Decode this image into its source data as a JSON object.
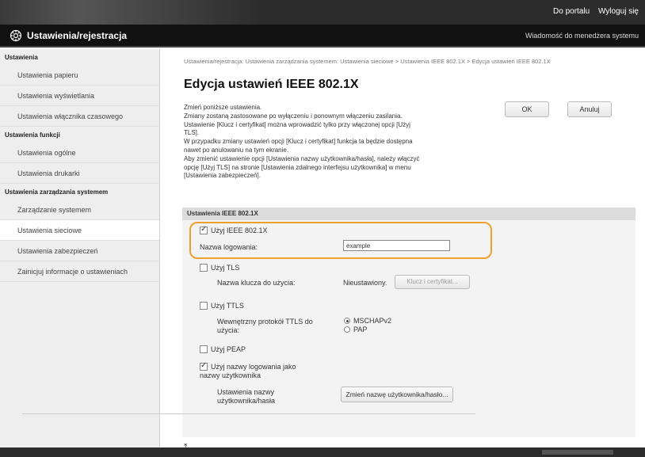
{
  "header": {
    "portal_link": "Do portalu",
    "logout_link": "Wyloguj się",
    "app_title": "Ustawienia/rejestracja",
    "system_message": "Wiadomość do menedżera systemu"
  },
  "sidebar": {
    "section1_title": "Ustawienia",
    "section1_items": [
      "Ustawienia papieru",
      "Ustawienia wyświetlania",
      "Ustawienia włącznika czasowego"
    ],
    "section2_title": "Ustawienia funkcji",
    "section2_items": [
      "Ustawienia ogólne",
      "Ustawienia drukarki"
    ],
    "section3_title": "Ustawienia zarządzania systemem",
    "section3_items": [
      "Zarządzanie systemem",
      "Ustawienia sieciowe",
      "Ustawienia zabezpieczeń",
      "Zainicjuj informacje o ustawieniach"
    ]
  },
  "main": {
    "breadcrumb": "Ustawienia/rejestracja: Ustawienia zarządzania systemem: Ustawienia sieciowe > Ustawienia IEEE 802.1X > Edycja ustawień IEEE 802.1X",
    "page_title": "Edycja ustawień IEEE 802.1X",
    "description": [
      "Zmień poniższe ustawienia.",
      "Zmiany zostaną zastosowane po wyłączeniu i ponownym włączeniu zasilania.",
      "Ustawienie [Klucz i certyfikat] można wprowadzić tylko przy włączonej opcji [Użyj",
      "TLS].",
      "W przypadku zmiany ustawień opcji [Klucz i certyfikat] funkcja ta będzie dostępna",
      "nawet po anulowaniu na tym ekranie.",
      "Aby zmienić ustawienie opcji [Ustawienia nazwy użytkownika/hasła], należy włączyć",
      "opcję [Użyj TLS] na stronie [Ustawienia zdalnego interfejsu użytkownika] w menu",
      "[Ustawienia zabezpieczeń]."
    ],
    "ok_label": "OK",
    "cancel_label": "Anuluj"
  },
  "section": {
    "title": "Ustawienia IEEE 802.1X",
    "use_ieee_label": "Użyj IEEE 802.1X",
    "use_ieee_checked": true,
    "login_name_label": "Nazwa logowania:",
    "login_name_value": "example",
    "use_tls_label": "Użyj TLS",
    "use_tls_checked": false,
    "key_label": "Nazwa klucza do użycia:",
    "key_value": "Nieustawiony.",
    "key_button": "Klucz i certyfikat...",
    "use_ttls_label": "Użyj TTLS",
    "use_ttls_checked": false,
    "ttls_protocol_label_line1": "Wewnętrzny protokół TTLS do",
    "ttls_protocol_label_line2": "użycia:",
    "ttls_options": [
      "MSCHAPv2",
      "PAP"
    ],
    "ttls_selected": "MSCHAPv2",
    "use_peap_label": "Użyj PEAP",
    "use_peap_checked": false,
    "use_login_as_user_line1": "Użyj nazwy logowania jako",
    "use_login_as_user_line2": "nazwy użytkownika",
    "use_login_as_user_checked": true,
    "user_settings_label_line1": "Ustawienia nazwy",
    "user_settings_label_line2": "użytkownika/hasła",
    "change_user_button": "Zmień nazwę użytkownika/hasło..."
  },
  "colors": {
    "highlight": "#f0a030",
    "topbar": "#2c2c2c",
    "titlebar": "#111111"
  }
}
